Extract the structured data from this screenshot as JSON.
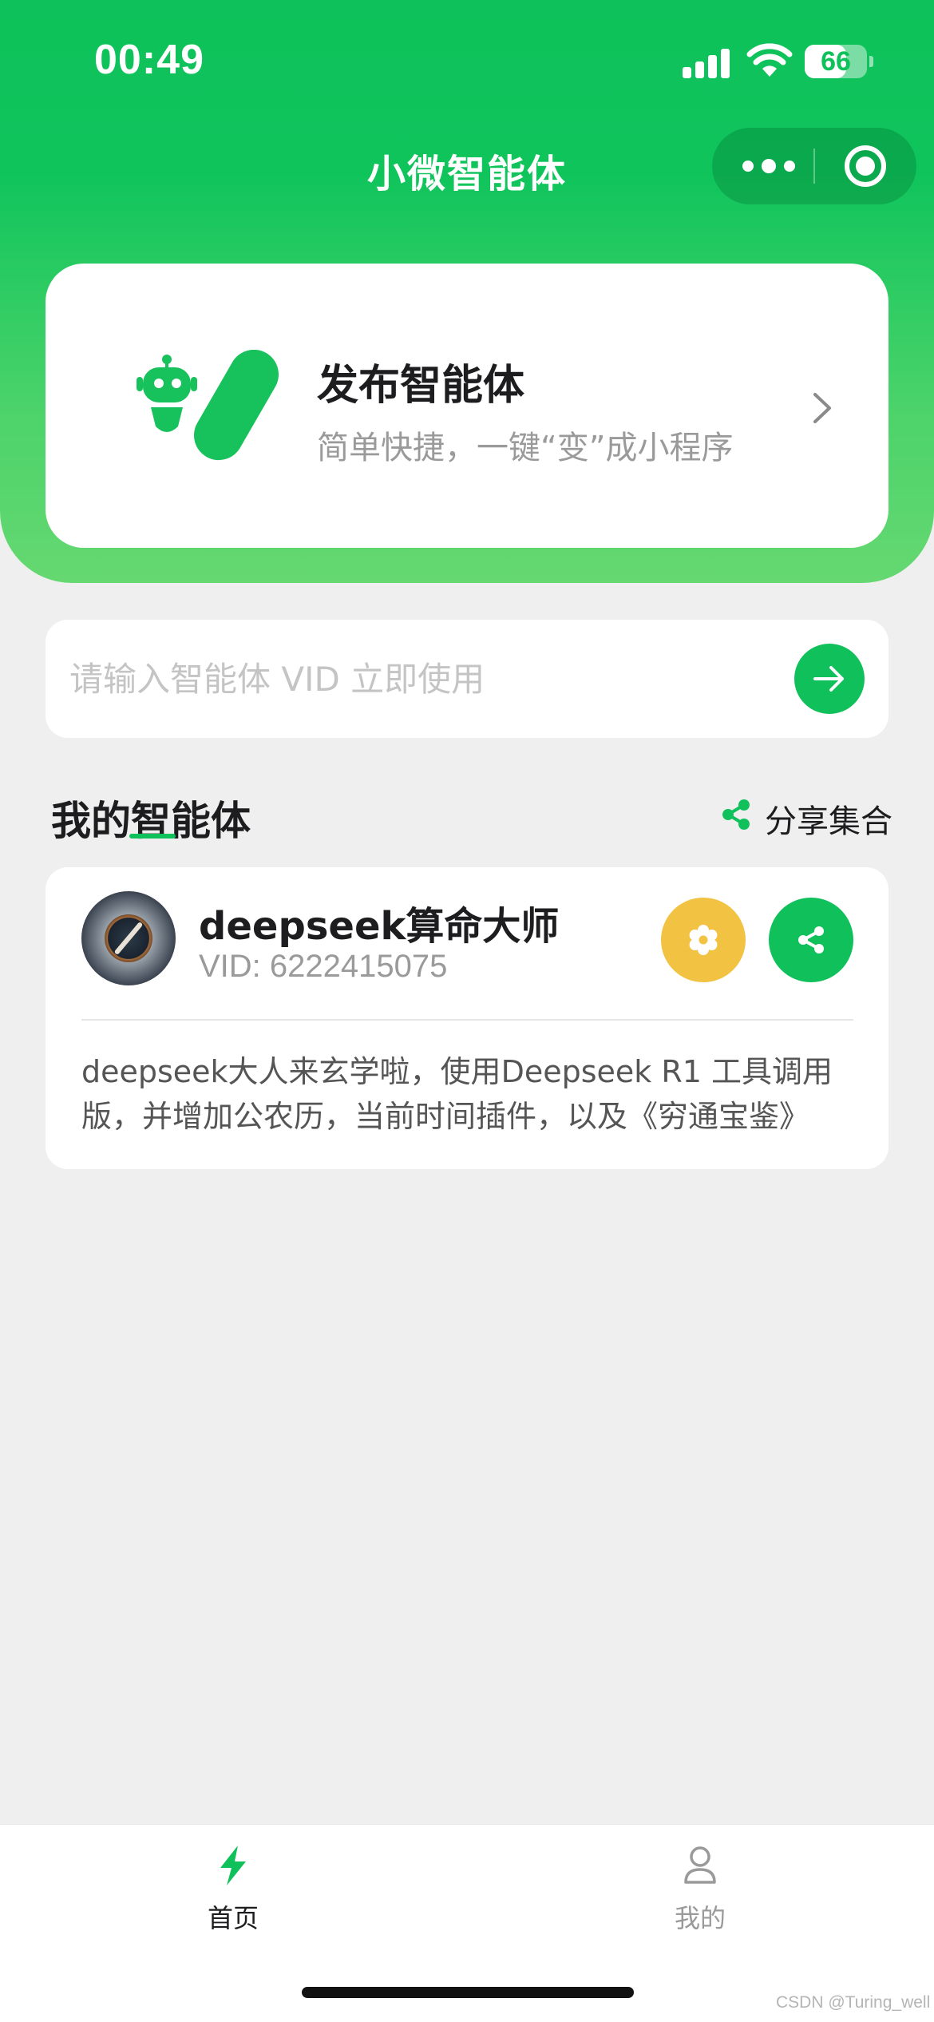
{
  "status_bar": {
    "time": "00:49",
    "battery": "66"
  },
  "nav": {
    "title": "小微智能体"
  },
  "publish": {
    "title": "发布智能体",
    "subtitle": "简单快捷，一键“变”成小程序"
  },
  "vid_search": {
    "placeholder": "请输入智能体 VID 立即使用",
    "value": ""
  },
  "section": {
    "title": "我的智能体",
    "share_all_label": "分享集合"
  },
  "agents": [
    {
      "name": "deepseek算命大师",
      "vid": "VID: 6222415075",
      "description": "deepseek大人来玄学啦，使用Deepseek R1 工具调用版，并增加公农历，当前时间插件，以及《穷通宝鉴》"
    }
  ],
  "tabbar": {
    "home": "首页",
    "me": "我的"
  },
  "watermark": "CSDN @Turing_well",
  "colors": {
    "brand_green": "#10c15b",
    "settings_yellow": "#f2c243",
    "background": "#efefef"
  },
  "icons": {
    "publish_logo": "robot-logo-icon",
    "chevron": "chevron-right-icon",
    "go": "arrow-right-icon",
    "share": "share-icon",
    "settings": "gear-icon",
    "home_tab": "lightning-icon",
    "me_tab": "user-icon"
  }
}
